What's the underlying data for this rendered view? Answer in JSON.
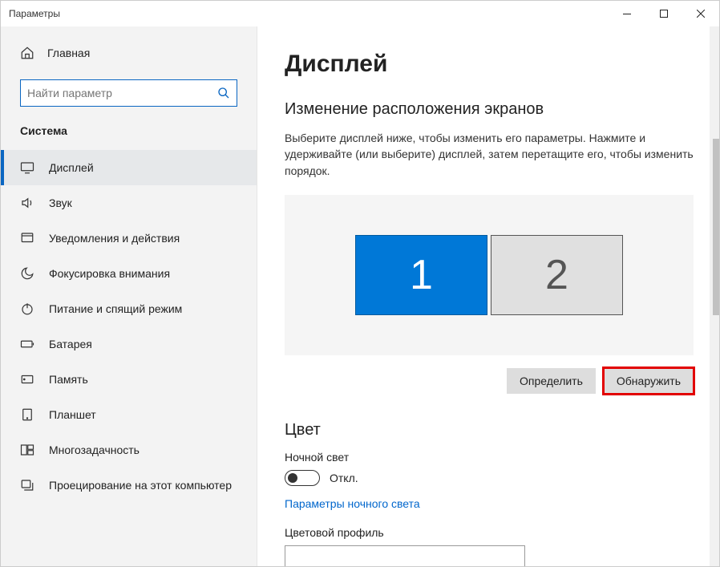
{
  "window": {
    "title": "Параметры"
  },
  "sidebar": {
    "home": "Главная",
    "search_placeholder": "Найти параметр",
    "section": "Система",
    "items": [
      {
        "label": "Дисплей"
      },
      {
        "label": "Звук"
      },
      {
        "label": "Уведомления и действия"
      },
      {
        "label": "Фокусировка внимания"
      },
      {
        "label": "Питание и спящий режим"
      },
      {
        "label": "Батарея"
      },
      {
        "label": "Память"
      },
      {
        "label": "Планшет"
      },
      {
        "label": "Многозадачность"
      },
      {
        "label": "Проецирование на этот компьютер"
      }
    ]
  },
  "main": {
    "title": "Дисплей",
    "arrange_heading": "Изменение расположения экранов",
    "arrange_help": "Выберите дисплей ниже, чтобы изменить его параметры. Нажмите и удерживайте (или выберите) дисплей, затем перетащите его, чтобы изменить порядок.",
    "monitor1": "1",
    "monitor2": "2",
    "identify": "Определить",
    "detect": "Обнаружить",
    "color_heading": "Цвет",
    "night_light_label": "Ночной свет",
    "toggle_state": "Откл.",
    "night_light_link": "Параметры ночного света",
    "color_profile": "Цветовой профиль"
  }
}
